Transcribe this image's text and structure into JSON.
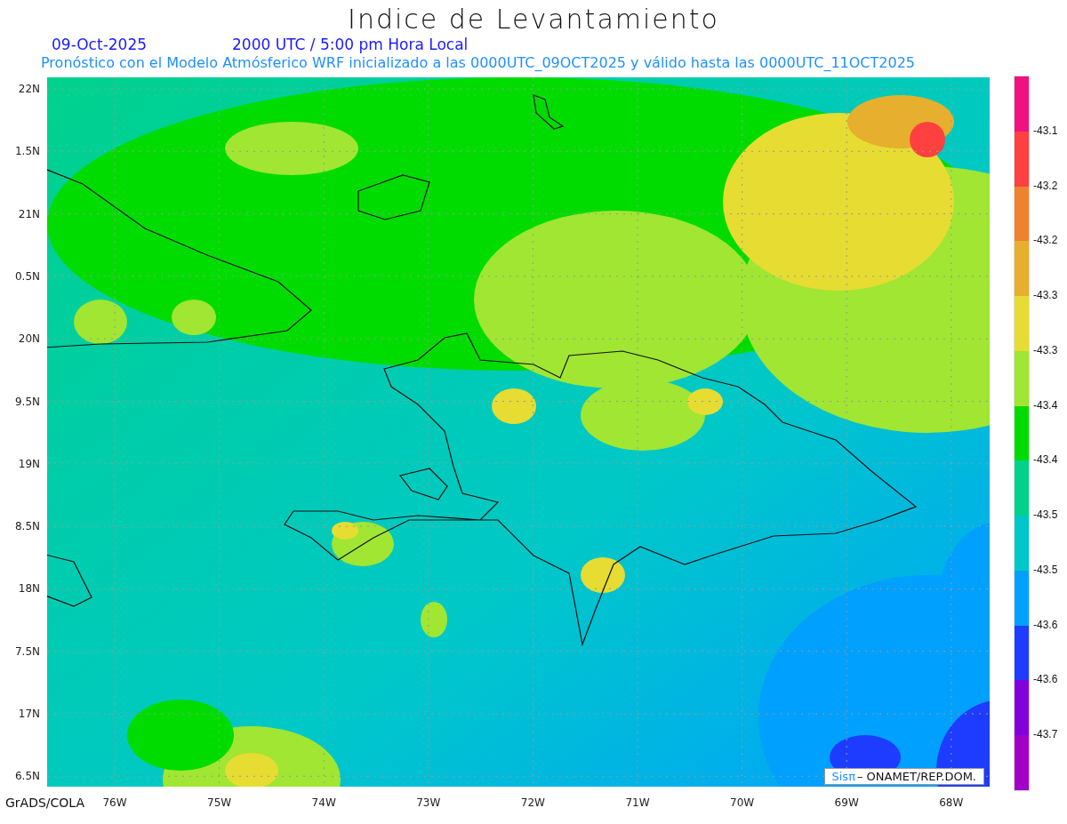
{
  "title": "Indice de Levantamiento",
  "date": "09-Oct-2025",
  "time": "2000 UTC / 5:00 pm Hora Local",
  "subtitle": "Pronóstico con el Modelo Atmósferico WRF inicializado a las 0000UTC_09OCT2025 y válido hasta las  0000UTC_11OCT2025",
  "map": {
    "kind": "picture"
  },
  "y_labels": [
    "22N",
    "1.5N",
    "21N",
    "0.5N",
    "20N",
    "9.5N",
    "19N",
    "8.5N",
    "18N",
    "7.5N",
    "17N",
    "6.5N"
  ],
  "x_labels": [
    "76W",
    "75W",
    "74W",
    "73W",
    "72W",
    "71W",
    "70W",
    "69W",
    "68W"
  ],
  "credit": {
    "brand": "Sisπ",
    "text": "– ONAMET/REP.DOM."
  },
  "software": "GrADS/COLA",
  "colorbar": {
    "segments": [
      {
        "color": "#f0127f"
      },
      {
        "color": "#ff4040"
      },
      {
        "color": "#f0822d"
      },
      {
        "color": "#e6af2d"
      },
      {
        "color": "#e6dc32"
      },
      {
        "color": "#a0e632"
      },
      {
        "color": "#00dc00"
      },
      {
        "color": "#00d28c"
      },
      {
        "color": "#00c8c8"
      },
      {
        "color": "#00a0ff"
      },
      {
        "color": "#1e3cff"
      },
      {
        "color": "#8200dc"
      },
      {
        "color": "#a000c8"
      }
    ],
    "labels": [
      "-43.1",
      "-43.2",
      "-43.2",
      "-43.3",
      "-43.3",
      "-43.4",
      "-43.4",
      "-43.5",
      "-43.5",
      "-43.6",
      "-43.6",
      "-43.7"
    ]
  }
}
